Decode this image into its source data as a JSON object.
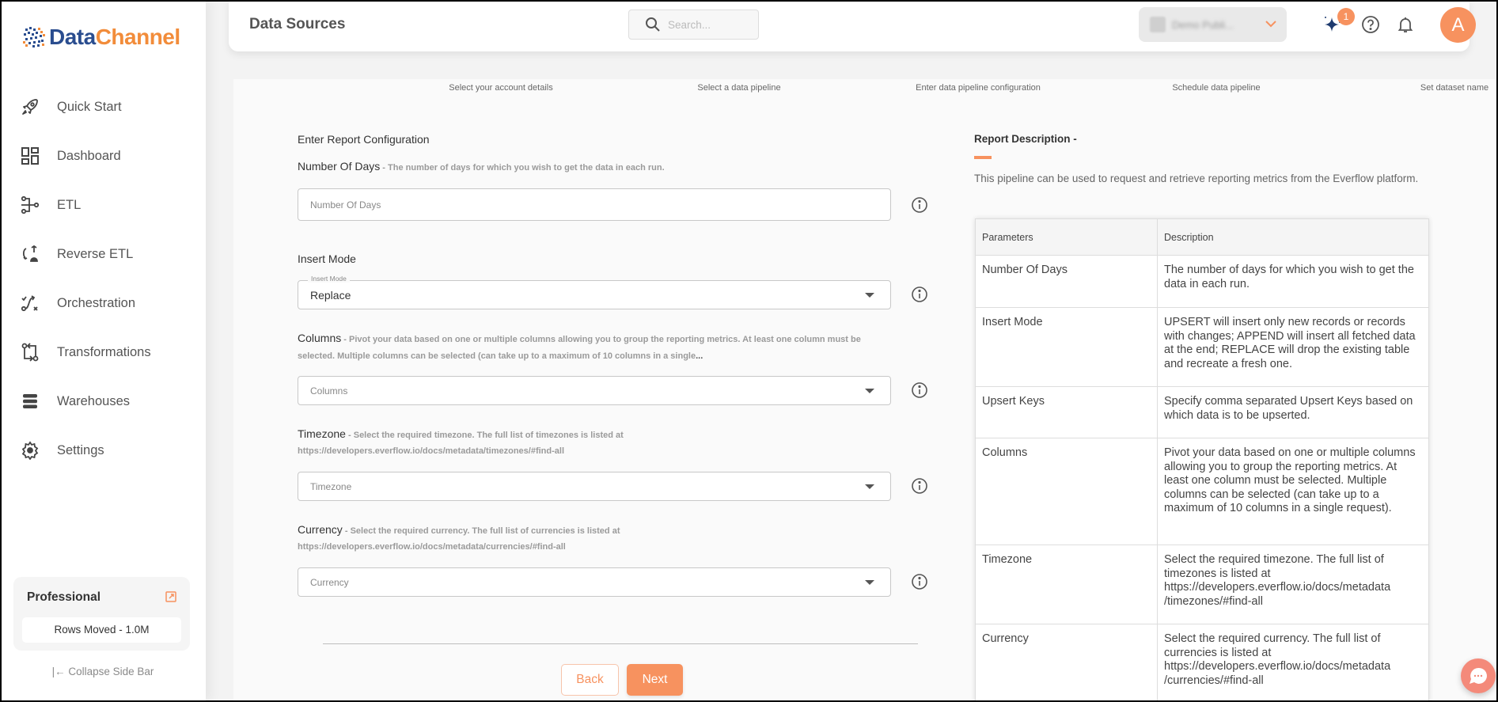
{
  "app": {
    "logo_part1": "Data",
    "logo_part2": "Channel",
    "brand_colors": {
      "primary_blue": "#2a4d8f",
      "accent_orange": "#f7925f"
    }
  },
  "sidebar": {
    "items": [
      {
        "label": "Quick Start",
        "icon": "rocket-icon"
      },
      {
        "label": "Dashboard",
        "icon": "dashboard-grid-icon"
      },
      {
        "label": "ETL",
        "icon": "etl-pipeline-icon"
      },
      {
        "label": "Reverse ETL",
        "icon": "reverse-etl-icon"
      },
      {
        "label": "Orchestration",
        "icon": "orchestration-icon"
      },
      {
        "label": "Transformations",
        "icon": "transformations-icon"
      },
      {
        "label": "Warehouses",
        "icon": "warehouse-stack-icon"
      },
      {
        "label": "Settings",
        "icon": "gear-icon"
      }
    ],
    "plan": {
      "name": "Professional",
      "rows_moved": "Rows Moved - 1.0M"
    },
    "collapse_label": "|← Collapse Side Bar"
  },
  "header": {
    "title": "Data Sources",
    "search_placeholder": "Search...",
    "workspace_name": "Demo Publi...",
    "notification_count": "1",
    "avatar_initial": "A"
  },
  "steps": [
    {
      "label": "Select your account details"
    },
    {
      "label": "Select a data pipeline"
    },
    {
      "label": "Enter data pipeline configuration"
    },
    {
      "label": "Schedule data pipeline"
    },
    {
      "label": "Set dataset name"
    }
  ],
  "form": {
    "section_title": "Enter Report Configuration",
    "fields": {
      "number_of_days": {
        "label": "Number Of Days",
        "hint": " - The number of days for which you wish to get the data in each run.",
        "placeholder": "Number Of Days"
      },
      "insert_mode": {
        "label": "Insert Mode",
        "floating_label": "Insert Mode",
        "value": "Replace"
      },
      "columns": {
        "label": "Columns",
        "hint": " - Pivot your data based on one or multiple columns allowing you to group the reporting metrics. At least one column must be selected. Multiple columns can be selected (can take up to a maximum of 10 columns in a single",
        "ellipsis": "...",
        "placeholder": "Columns"
      },
      "timezone": {
        "label": "Timezone",
        "hint": " - Select the required timezone. The full list of timezones is listed at",
        "hint_line2": "https://developers.everflow.io/docs/metadata/timezones/#find-all",
        "placeholder": "Timezone"
      },
      "currency": {
        "label": "Currency",
        "hint": " - Select the required currency. The full list of currencies is listed at",
        "hint_line2": "https://developers.everflow.io/docs/metadata/currencies/#find-all",
        "placeholder": "Currency"
      }
    },
    "back_label": "Back",
    "next_label": "Next"
  },
  "description": {
    "title": "Report Description -",
    "text": "This pipeline can be used to request and retrieve reporting metrics from the Everflow platform.",
    "table": {
      "headers": [
        "Parameters",
        "Description"
      ],
      "rows": [
        [
          "Number Of Days",
          "The number of days for which you wish to get the data in each run."
        ],
        [
          "Insert Mode",
          "UPSERT will insert only new records or records with changes; APPEND will insert all fetched data at the end; REPLACE will drop the existing table and recreate a fresh one."
        ],
        [
          "Upsert Keys",
          "Specify comma separated Upsert Keys based on which data is to be upserted."
        ],
        [
          "Columns",
          "Pivot your data based on one or multiple columns allowing you to group the reporting metrics. At least one column must be selected. Multiple columns can be selected (can take up to a maximum of 10 columns in a single request)."
        ],
        [
          "Timezone",
          "Select the required timezone. The full list of timezones is listed at https://developers.everflow.io/docs/metadata /timezones/#find-all"
        ],
        [
          "Currency",
          "Select the required currency. The full list of currencies is listed at https://developers.everflow.io/docs/metadata /currencies/#find-all"
        ]
      ]
    }
  }
}
